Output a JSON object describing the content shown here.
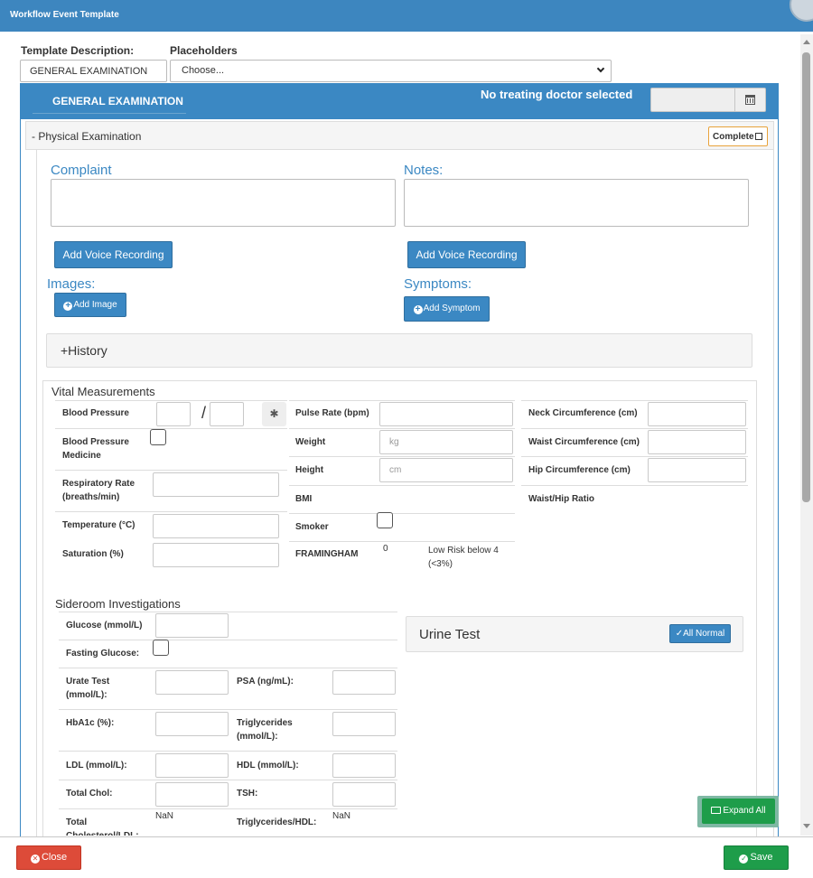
{
  "window": {
    "title": "Workflow Event Template"
  },
  "header": {
    "template_description_label": "Template Description:",
    "template_description_value": "GENERAL EXAMINATION",
    "placeholders_label": "Placeholders",
    "placeholders_selected": "Choose..."
  },
  "tabbar": {
    "tab_label": "GENERAL EXAMINATION",
    "doctor_status": "No treating doctor selected"
  },
  "section": {
    "title": "- Physical Examination",
    "complete_label": "Complete"
  },
  "notes": {
    "complaint_label": "Complaint",
    "notes_label": "Notes:",
    "voice_btn_1": "Add Voice Recording",
    "voice_btn_2": "Add Voice Recording",
    "images_label": "Images:",
    "add_image_btn": "Add Image",
    "symptoms_label": "Symptoms:",
    "add_symptom_btn": "Add Symptom"
  },
  "history": {
    "label": "+History"
  },
  "vitals": {
    "heading": "Vital Measurements",
    "blood_pressure": "Blood Pressure",
    "bp_separator": "/",
    "bp_medicine": "Blood Pressure Medicine",
    "respiratory_rate": "Respiratory Rate (breaths/min)",
    "temperature": "Temperature (°C)",
    "saturation": "Saturation (%)",
    "pulse_rate": "Pulse Rate (bpm)",
    "weight": "Weight",
    "weight_placeholder": "kg",
    "height": "Height",
    "height_placeholder": "cm",
    "bmi": "BMI",
    "smoker": "Smoker",
    "framingham": "FRAMINGHAM",
    "framingham_value": "0",
    "framingham_note": "Low Risk below 4 (<3%)",
    "neck": "Neck Circumference (cm)",
    "waist": "Waist Circumference (cm)",
    "hip": "Hip Circumference (cm)",
    "waist_hip": "Waist/Hip Ratio"
  },
  "sideroom": {
    "heading": "Sideroom Investigations",
    "glucose": "Glucose (mmol/L)",
    "fasting_glucose": "Fasting Glucose:",
    "urate": "Urate Test (mmol/L):",
    "psa": "PSA (ng/mL):",
    "hba1c": "HbA1c (%):",
    "triglycerides": "Triglycerides (mmol/L):",
    "ldl": "LDL (mmol/L):",
    "hdl": "HDL (mmol/L):",
    "total_chol": "Total Chol:",
    "tsh": "TSH:",
    "total_chol_ldl": "Total Cholesterol/LDL:",
    "total_chol_ldl_value": "NaN",
    "trig_hdl": "Triglycerides/HDL:",
    "trig_hdl_value": "NaN"
  },
  "urine": {
    "label": "Urine Test",
    "all_normal_btn": "All Normal"
  },
  "footer": {
    "expand_all": "Expand All",
    "close": "Close",
    "save": "Save"
  },
  "colors": {
    "primary": "#3b88c3",
    "danger": "#dd4b39",
    "success": "#1e9d4a",
    "warning_border": "#e8a33b"
  },
  "icons": [
    "calendar-icon",
    "bluetooth-icon",
    "plus-circle-icon",
    "check-icon",
    "folder-open-icon",
    "times-circle-icon",
    "check-circle-icon",
    "chevron-down-icon"
  ]
}
